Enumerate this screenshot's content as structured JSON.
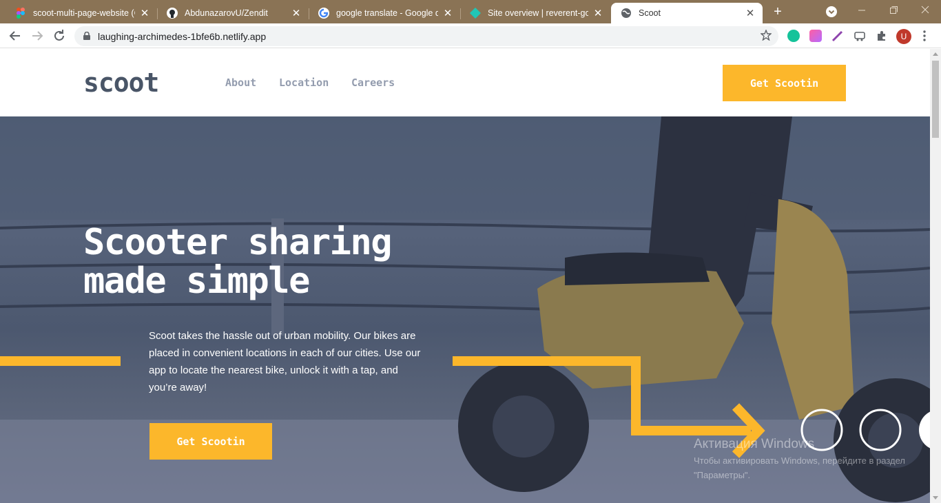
{
  "browser": {
    "tabs": [
      {
        "title": "scoot-multi-page-website (Co",
        "icon": "figma-icon",
        "active": false
      },
      {
        "title": "AbdunazarovU/Zendit",
        "icon": "github-icon",
        "active": false
      },
      {
        "title": "google translate - Google qid",
        "icon": "google-icon",
        "active": false
      },
      {
        "title": "Site overview | reverent-golds",
        "icon": "netlify-icon",
        "active": false
      },
      {
        "title": "Scoot",
        "icon": "globe-icon",
        "active": true
      }
    ],
    "close_glyph": "✕",
    "new_tab_glyph": "+",
    "address_bar": {
      "url": "laughing-archimedes-1bfe6b.netlify.app"
    },
    "profile_initial": "U"
  },
  "site": {
    "logo": "scoot",
    "nav": [
      {
        "label": "About"
      },
      {
        "label": "Location"
      },
      {
        "label": "Careers"
      }
    ],
    "header_cta": "Get Scootin",
    "hero": {
      "title": "Scooter sharing made simple",
      "text": "Scoot takes the hassle out of urban mobility. Our bikes are placed in convenient locations in each of our cities. Use our app to locate the nearest bike, unlock it with a tap, and you’re away!",
      "cta": "Get Scootin"
    }
  },
  "os_overlay": {
    "activation_title": "Активация Windows",
    "activation_text": "Чтобы активировать Windows, перейдите в раздел \"Параметры\"."
  },
  "colors": {
    "accent": "#fcb72b",
    "dark_navy": "#495567",
    "nav_gray": "#939cae"
  }
}
